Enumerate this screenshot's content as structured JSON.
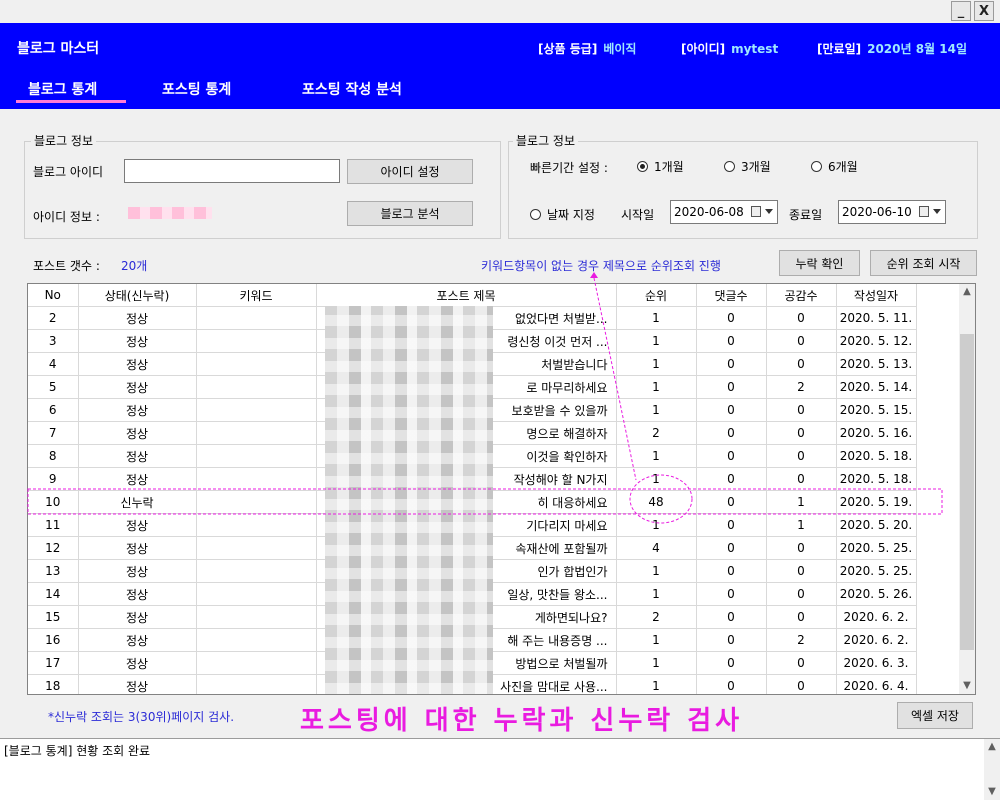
{
  "window": {
    "minimize": "_",
    "close": "X"
  },
  "header": {
    "app_title": "블로그 마스터",
    "product_label": "[상품 등급]",
    "product_value": "베이직",
    "id_label": "[아이디]",
    "id_value": "mytest",
    "expire_label": "[만료일]",
    "expire_value": "2020년 8월 14일"
  },
  "nav": {
    "tabs": [
      "블로그 통계",
      "포스팅 통계",
      "포스팅 작성 분석"
    ],
    "active": 0
  },
  "blog_info": {
    "title": "블로그 정보",
    "id_label": "블로그 아이디",
    "id_value": "",
    "set_button": "아이디 설정",
    "info_label": "아이디 정보 :",
    "analyze_button": "블로그 분석"
  },
  "period": {
    "title": "블로그 정보",
    "quick_label": "빠른기간 설정 :",
    "options": [
      "1개월",
      "3개월",
      "6개월"
    ],
    "selected": "1개월",
    "date_option": "날짜 지정",
    "start_label": "시작일",
    "start_value": "2020-06-08",
    "end_label": "종료일",
    "end_value": "2020-06-10"
  },
  "summary": {
    "count_label": "포스트 갯수 :",
    "count_value": "20개",
    "hint": "키워드항목이 없는 경우 제목으로 순위조회 진행",
    "check_button": "누락 확인",
    "rank_button": "순위 조회 시작"
  },
  "table": {
    "columns": [
      "No",
      "상태(신누락)",
      "키워드",
      "포스트 제목",
      "순위",
      "댓글수",
      "공감수",
      "작성일자"
    ],
    "rows": [
      {
        "no": "2",
        "status": "정상",
        "keyword": "",
        "title": "없었다면 처벌받...",
        "rank": "1",
        "comments": "0",
        "likes": "0",
        "date": "2020. 5. 11."
      },
      {
        "no": "3",
        "status": "정상",
        "keyword": "",
        "title": "령신청 이것 먼저 ...",
        "rank": "1",
        "comments": "0",
        "likes": "0",
        "date": "2020. 5. 12."
      },
      {
        "no": "4",
        "status": "정상",
        "keyword": "",
        "title": "처벌받습니다",
        "rank": "1",
        "comments": "0",
        "likes": "0",
        "date": "2020. 5. 13."
      },
      {
        "no": "5",
        "status": "정상",
        "keyword": "",
        "title": "로 마무리하세요",
        "rank": "1",
        "comments": "0",
        "likes": "2",
        "date": "2020. 5. 14."
      },
      {
        "no": "6",
        "status": "정상",
        "keyword": "",
        "title": "보호받을 수 있을까",
        "rank": "1",
        "comments": "0",
        "likes": "0",
        "date": "2020. 5. 15."
      },
      {
        "no": "7",
        "status": "정상",
        "keyword": "",
        "title": "명으로 해결하자",
        "rank": "2",
        "comments": "0",
        "likes": "0",
        "date": "2020. 5. 16."
      },
      {
        "no": "8",
        "status": "정상",
        "keyword": "",
        "title": "이것을 확인하자",
        "rank": "1",
        "comments": "0",
        "likes": "0",
        "date": "2020. 5. 18."
      },
      {
        "no": "9",
        "status": "정상",
        "keyword": "",
        "title": "작성해야 할 N가지",
        "rank": "1",
        "comments": "0",
        "likes": "0",
        "date": "2020. 5. 18."
      },
      {
        "no": "10",
        "status": "신누락",
        "keyword": "",
        "title": "히 대응하세요",
        "rank": "48",
        "comments": "0",
        "likes": "1",
        "date": "2020. 5. 19."
      },
      {
        "no": "11",
        "status": "정상",
        "keyword": "",
        "title": "기다리지 마세요",
        "rank": "1",
        "comments": "0",
        "likes": "1",
        "date": "2020. 5. 20."
      },
      {
        "no": "12",
        "status": "정상",
        "keyword": "",
        "title": "속재산에 포함될까",
        "rank": "4",
        "comments": "0",
        "likes": "0",
        "date": "2020. 5. 25."
      },
      {
        "no": "13",
        "status": "정상",
        "keyword": "",
        "title": "인가 합법인가",
        "rank": "1",
        "comments": "0",
        "likes": "0",
        "date": "2020. 5. 25."
      },
      {
        "no": "14",
        "status": "정상",
        "keyword": "",
        "title": "일상, 맛찬들 왕소...",
        "rank": "1",
        "comments": "0",
        "likes": "0",
        "date": "2020. 5. 26."
      },
      {
        "no": "15",
        "status": "정상",
        "keyword": "",
        "title": "게하면되나요?",
        "rank": "2",
        "comments": "0",
        "likes": "0",
        "date": "2020. 6. 2."
      },
      {
        "no": "16",
        "status": "정상",
        "keyword": "",
        "title": "해 주는 내용증명 ...",
        "rank": "1",
        "comments": "0",
        "likes": "2",
        "date": "2020. 6. 2."
      },
      {
        "no": "17",
        "status": "정상",
        "keyword": "",
        "title": "방법으로 처벌될까",
        "rank": "1",
        "comments": "0",
        "likes": "0",
        "date": "2020. 6. 3."
      },
      {
        "no": "18",
        "status": "정상",
        "keyword": "",
        "title": "사진을 맘대로 사용...",
        "rank": "1",
        "comments": "0",
        "likes": "0",
        "date": "2020. 6. 4."
      }
    ]
  },
  "footer": {
    "note": "*신누락 조회는 3(30위)페이지 검사.",
    "caption": "포스팅에 대한 누락과 신누락 검사",
    "excel_button": "엑셀 저장"
  },
  "log": {
    "text": "[블로그 통계] 현황 조회 완료"
  },
  "colors": {
    "header_bg": "#0000ff",
    "accent": "#e91be0",
    "info_value": "#9fe8ff"
  }
}
